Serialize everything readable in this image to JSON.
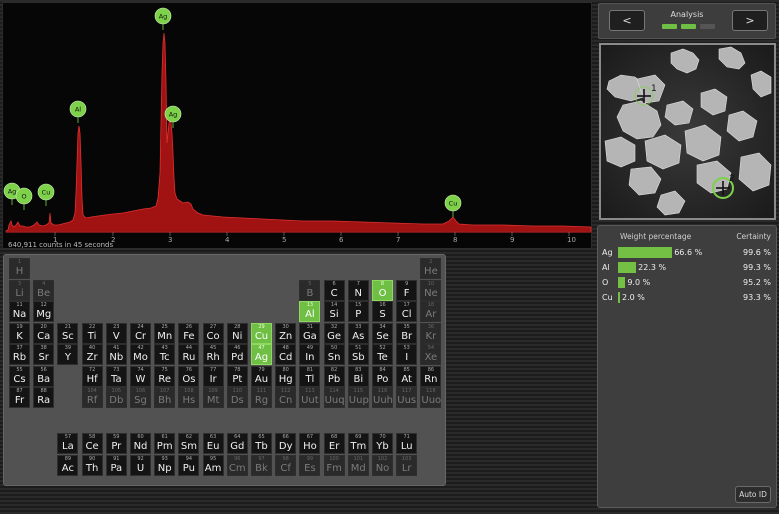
{
  "spectrum": {
    "counts_text": "640,911 counts in 45 seconds",
    "x_ticks": [
      "1",
      "2",
      "3",
      "4",
      "5",
      "6",
      "7",
      "8",
      "9",
      "10"
    ],
    "peak_labels": [
      "Ag",
      "Al",
      "Ag",
      "Cu",
      "Ag",
      "O",
      "Cu"
    ],
    "colors": {
      "fill": "#b01515",
      "label": "#7dd24a"
    }
  },
  "periodic_table": {
    "elements": [
      {
        "n": "1",
        "s": "H",
        "r": 1,
        "c": 1,
        "st": "dim"
      },
      {
        "n": "2",
        "s": "He",
        "r": 1,
        "c": 18,
        "st": "dim"
      },
      {
        "n": "3",
        "s": "Li",
        "r": 2,
        "c": 1,
        "st": "dim"
      },
      {
        "n": "4",
        "s": "Be",
        "r": 2,
        "c": 2,
        "st": "dim"
      },
      {
        "n": "5",
        "s": "B",
        "r": 2,
        "c": 13,
        "st": "dim"
      },
      {
        "n": "6",
        "s": "C",
        "r": 2,
        "c": 14,
        "st": ""
      },
      {
        "n": "7",
        "s": "N",
        "r": 2,
        "c": 15,
        "st": ""
      },
      {
        "n": "8",
        "s": "O",
        "r": 2,
        "c": 16,
        "st": "sel"
      },
      {
        "n": "9",
        "s": "F",
        "r": 2,
        "c": 17,
        "st": ""
      },
      {
        "n": "10",
        "s": "Ne",
        "r": 2,
        "c": 18,
        "st": "dim"
      },
      {
        "n": "11",
        "s": "Na",
        "r": 3,
        "c": 1,
        "st": ""
      },
      {
        "n": "12",
        "s": "Mg",
        "r": 3,
        "c": 2,
        "st": ""
      },
      {
        "n": "13",
        "s": "Al",
        "r": 3,
        "c": 13,
        "st": "sel"
      },
      {
        "n": "14",
        "s": "Si",
        "r": 3,
        "c": 14,
        "st": ""
      },
      {
        "n": "15",
        "s": "P",
        "r": 3,
        "c": 15,
        "st": ""
      },
      {
        "n": "16",
        "s": "S",
        "r": 3,
        "c": 16,
        "st": ""
      },
      {
        "n": "17",
        "s": "Cl",
        "r": 3,
        "c": 17,
        "st": ""
      },
      {
        "n": "18",
        "s": "Ar",
        "r": 3,
        "c": 18,
        "st": "dim"
      },
      {
        "n": "19",
        "s": "K",
        "r": 4,
        "c": 1,
        "st": ""
      },
      {
        "n": "20",
        "s": "Ca",
        "r": 4,
        "c": 2,
        "st": ""
      },
      {
        "n": "21",
        "s": "Sc",
        "r": 4,
        "c": 3,
        "st": ""
      },
      {
        "n": "22",
        "s": "Ti",
        "r": 4,
        "c": 4,
        "st": ""
      },
      {
        "n": "23",
        "s": "V",
        "r": 4,
        "c": 5,
        "st": ""
      },
      {
        "n": "24",
        "s": "Cr",
        "r": 4,
        "c": 6,
        "st": ""
      },
      {
        "n": "25",
        "s": "Mn",
        "r": 4,
        "c": 7,
        "st": ""
      },
      {
        "n": "26",
        "s": "Fe",
        "r": 4,
        "c": 8,
        "st": ""
      },
      {
        "n": "27",
        "s": "Co",
        "r": 4,
        "c": 9,
        "st": ""
      },
      {
        "n": "28",
        "s": "Ni",
        "r": 4,
        "c": 10,
        "st": ""
      },
      {
        "n": "29",
        "s": "Cu",
        "r": 4,
        "c": 11,
        "st": "sel"
      },
      {
        "n": "30",
        "s": "Zn",
        "r": 4,
        "c": 12,
        "st": ""
      },
      {
        "n": "31",
        "s": "Ga",
        "r": 4,
        "c": 13,
        "st": ""
      },
      {
        "n": "32",
        "s": "Ge",
        "r": 4,
        "c": 14,
        "st": ""
      },
      {
        "n": "33",
        "s": "As",
        "r": 4,
        "c": 15,
        "st": ""
      },
      {
        "n": "34",
        "s": "Se",
        "r": 4,
        "c": 16,
        "st": ""
      },
      {
        "n": "35",
        "s": "Br",
        "r": 4,
        "c": 17,
        "st": ""
      },
      {
        "n": "36",
        "s": "Kr",
        "r": 4,
        "c": 18,
        "st": "dim"
      },
      {
        "n": "37",
        "s": "Rb",
        "r": 5,
        "c": 1,
        "st": ""
      },
      {
        "n": "38",
        "s": "Sr",
        "r": 5,
        "c": 2,
        "st": ""
      },
      {
        "n": "39",
        "s": "Y",
        "r": 5,
        "c": 3,
        "st": ""
      },
      {
        "n": "40",
        "s": "Zr",
        "r": 5,
        "c": 4,
        "st": ""
      },
      {
        "n": "41",
        "s": "Nb",
        "r": 5,
        "c": 5,
        "st": ""
      },
      {
        "n": "42",
        "s": "Mo",
        "r": 5,
        "c": 6,
        "st": ""
      },
      {
        "n": "43",
        "s": "Tc",
        "r": 5,
        "c": 7,
        "st": ""
      },
      {
        "n": "44",
        "s": "Ru",
        "r": 5,
        "c": 8,
        "st": ""
      },
      {
        "n": "45",
        "s": "Rh",
        "r": 5,
        "c": 9,
        "st": ""
      },
      {
        "n": "46",
        "s": "Pd",
        "r": 5,
        "c": 10,
        "st": ""
      },
      {
        "n": "47",
        "s": "Ag",
        "r": 5,
        "c": 11,
        "st": "sel"
      },
      {
        "n": "48",
        "s": "Cd",
        "r": 5,
        "c": 12,
        "st": ""
      },
      {
        "n": "49",
        "s": "In",
        "r": 5,
        "c": 13,
        "st": ""
      },
      {
        "n": "50",
        "s": "Sn",
        "r": 5,
        "c": 14,
        "st": ""
      },
      {
        "n": "51",
        "s": "Sb",
        "r": 5,
        "c": 15,
        "st": ""
      },
      {
        "n": "52",
        "s": "Te",
        "r": 5,
        "c": 16,
        "st": ""
      },
      {
        "n": "53",
        "s": "I",
        "r": 5,
        "c": 17,
        "st": ""
      },
      {
        "n": "54",
        "s": "Xe",
        "r": 5,
        "c": 18,
        "st": "dim"
      },
      {
        "n": "55",
        "s": "Cs",
        "r": 6,
        "c": 1,
        "st": ""
      },
      {
        "n": "56",
        "s": "Ba",
        "r": 6,
        "c": 2,
        "st": ""
      },
      {
        "n": "72",
        "s": "Hf",
        "r": 6,
        "c": 4,
        "st": ""
      },
      {
        "n": "73",
        "s": "Ta",
        "r": 6,
        "c": 5,
        "st": ""
      },
      {
        "n": "74",
        "s": "W",
        "r": 6,
        "c": 6,
        "st": ""
      },
      {
        "n": "75",
        "s": "Re",
        "r": 6,
        "c": 7,
        "st": ""
      },
      {
        "n": "76",
        "s": "Os",
        "r": 6,
        "c": 8,
        "st": ""
      },
      {
        "n": "77",
        "s": "Ir",
        "r": 6,
        "c": 9,
        "st": ""
      },
      {
        "n": "78",
        "s": "Pt",
        "r": 6,
        "c": 10,
        "st": ""
      },
      {
        "n": "79",
        "s": "Au",
        "r": 6,
        "c": 11,
        "st": ""
      },
      {
        "n": "80",
        "s": "Hg",
        "r": 6,
        "c": 12,
        "st": ""
      },
      {
        "n": "81",
        "s": "Tl",
        "r": 6,
        "c": 13,
        "st": ""
      },
      {
        "n": "82",
        "s": "Pb",
        "r": 6,
        "c": 14,
        "st": ""
      },
      {
        "n": "83",
        "s": "Bi",
        "r": 6,
        "c": 15,
        "st": ""
      },
      {
        "n": "84",
        "s": "Po",
        "r": 6,
        "c": 16,
        "st": ""
      },
      {
        "n": "85",
        "s": "At",
        "r": 6,
        "c": 17,
        "st": ""
      },
      {
        "n": "86",
        "s": "Rn",
        "r": 6,
        "c": 18,
        "st": ""
      },
      {
        "n": "87",
        "s": "Fr",
        "r": 7,
        "c": 1,
        "st": ""
      },
      {
        "n": "88",
        "s": "Ra",
        "r": 7,
        "c": 2,
        "st": ""
      },
      {
        "n": "104",
        "s": "Rf",
        "r": 7,
        "c": 4,
        "st": "dim"
      },
      {
        "n": "105",
        "s": "Db",
        "r": 7,
        "c": 5,
        "st": "dim"
      },
      {
        "n": "106",
        "s": "Sg",
        "r": 7,
        "c": 6,
        "st": "dim"
      },
      {
        "n": "107",
        "s": "Bh",
        "r": 7,
        "c": 7,
        "st": "dim"
      },
      {
        "n": "108",
        "s": "Hs",
        "r": 7,
        "c": 8,
        "st": "dim"
      },
      {
        "n": "109",
        "s": "Mt",
        "r": 7,
        "c": 9,
        "st": "dim"
      },
      {
        "n": "110",
        "s": "Ds",
        "r": 7,
        "c": 10,
        "st": "dim"
      },
      {
        "n": "111",
        "s": "Rg",
        "r": 7,
        "c": 11,
        "st": "dim"
      },
      {
        "n": "112",
        "s": "Cn",
        "r": 7,
        "c": 12,
        "st": "dim"
      },
      {
        "n": "113",
        "s": "Uut",
        "r": 7,
        "c": 13,
        "st": "dim"
      },
      {
        "n": "114",
        "s": "Uuq",
        "r": 7,
        "c": 14,
        "st": "dim"
      },
      {
        "n": "115",
        "s": "Uup",
        "r": 7,
        "c": 15,
        "st": "dim"
      },
      {
        "n": "116",
        "s": "Uuh",
        "r": 7,
        "c": 16,
        "st": "dim"
      },
      {
        "n": "117",
        "s": "Uus",
        "r": 7,
        "c": 17,
        "st": "dim"
      },
      {
        "n": "118",
        "s": "Uuo",
        "r": 7,
        "c": 18,
        "st": "dim"
      },
      {
        "n": "57",
        "s": "La",
        "r": 9,
        "c": 3,
        "st": ""
      },
      {
        "n": "58",
        "s": "Ce",
        "r": 9,
        "c": 4,
        "st": ""
      },
      {
        "n": "59",
        "s": "Pr",
        "r": 9,
        "c": 5,
        "st": ""
      },
      {
        "n": "60",
        "s": "Nd",
        "r": 9,
        "c": 6,
        "st": ""
      },
      {
        "n": "61",
        "s": "Pm",
        "r": 9,
        "c": 7,
        "st": ""
      },
      {
        "n": "62",
        "s": "Sm",
        "r": 9,
        "c": 8,
        "st": ""
      },
      {
        "n": "63",
        "s": "Eu",
        "r": 9,
        "c": 9,
        "st": ""
      },
      {
        "n": "64",
        "s": "Gd",
        "r": 9,
        "c": 10,
        "st": ""
      },
      {
        "n": "65",
        "s": "Tb",
        "r": 9,
        "c": 11,
        "st": ""
      },
      {
        "n": "66",
        "s": "Dy",
        "r": 9,
        "c": 12,
        "st": ""
      },
      {
        "n": "67",
        "s": "Ho",
        "r": 9,
        "c": 13,
        "st": ""
      },
      {
        "n": "68",
        "s": "Er",
        "r": 9,
        "c": 14,
        "st": ""
      },
      {
        "n": "69",
        "s": "Tm",
        "r": 9,
        "c": 15,
        "st": ""
      },
      {
        "n": "70",
        "s": "Yb",
        "r": 9,
        "c": 16,
        "st": ""
      },
      {
        "n": "71",
        "s": "Lu",
        "r": 9,
        "c": 17,
        "st": ""
      },
      {
        "n": "89",
        "s": "Ac",
        "r": 10,
        "c": 3,
        "st": ""
      },
      {
        "n": "90",
        "s": "Th",
        "r": 10,
        "c": 4,
        "st": ""
      },
      {
        "n": "91",
        "s": "Pa",
        "r": 10,
        "c": 5,
        "st": ""
      },
      {
        "n": "92",
        "s": "U",
        "r": 10,
        "c": 6,
        "st": ""
      },
      {
        "n": "93",
        "s": "Np",
        "r": 10,
        "c": 7,
        "st": ""
      },
      {
        "n": "94",
        "s": "Pu",
        "r": 10,
        "c": 8,
        "st": ""
      },
      {
        "n": "95",
        "s": "Am",
        "r": 10,
        "c": 9,
        "st": ""
      },
      {
        "n": "96",
        "s": "Cm",
        "r": 10,
        "c": 10,
        "st": "dim"
      },
      {
        "n": "97",
        "s": "Bk",
        "r": 10,
        "c": 11,
        "st": "dim"
      },
      {
        "n": "98",
        "s": "Cf",
        "r": 10,
        "c": 12,
        "st": "dim"
      },
      {
        "n": "99",
        "s": "Es",
        "r": 10,
        "c": 13,
        "st": "dim"
      },
      {
        "n": "100",
        "s": "Fm",
        "r": 10,
        "c": 14,
        "st": "dim"
      },
      {
        "n": "101",
        "s": "Md",
        "r": 10,
        "c": 15,
        "st": "dim"
      },
      {
        "n": "102",
        "s": "No",
        "r": 10,
        "c": 16,
        "st": "dim"
      },
      {
        "n": "103",
        "s": "Lr",
        "r": 10,
        "c": 17,
        "st": "dim"
      }
    ]
  },
  "analysis_nav": {
    "title": "Analysis",
    "prev_label": "<",
    "next_label": ">",
    "progress_states": [
      "done",
      "done",
      "pending"
    ],
    "colors": {
      "done": "#6fbf44",
      "pending": "#555555"
    }
  },
  "micrograph": {
    "markers": [
      "1",
      "2"
    ]
  },
  "results": {
    "header_weight": "Weight percentage",
    "header_certainty": "Certainty",
    "rows": [
      {
        "element": "Ag",
        "weight": 66.6,
        "weight_text": "66.6 %",
        "certainty": "99.6 %"
      },
      {
        "element": "Al",
        "weight": 22.3,
        "weight_text": "22.3 %",
        "certainty": "99.3 %"
      },
      {
        "element": "O",
        "weight": 9.0,
        "weight_text": "9.0 %",
        "certainty": "95.2 %"
      },
      {
        "element": "Cu",
        "weight": 2.0,
        "weight_text": "2.0 %",
        "certainty": "93.3 %"
      }
    ],
    "auto_id_label": "Auto ID",
    "bar_color": "#73c045"
  }
}
